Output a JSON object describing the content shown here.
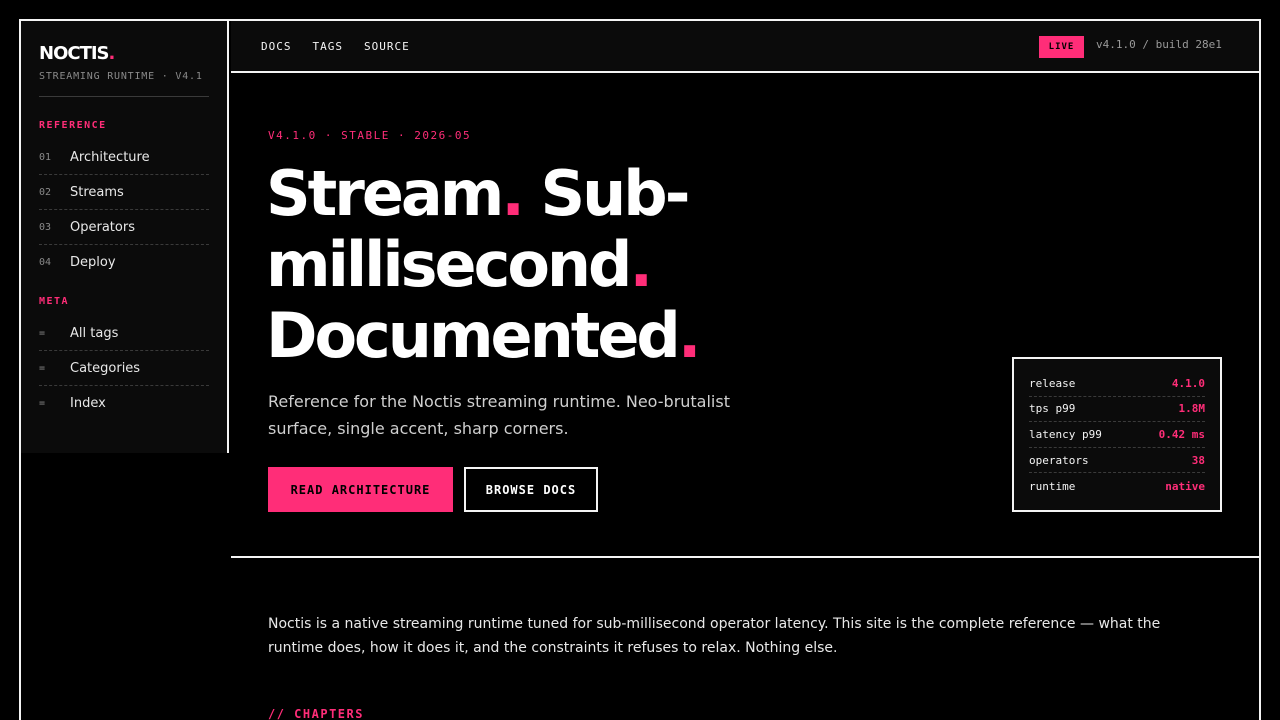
{
  "brand": {
    "name": "NOCTIS",
    "dot": ".",
    "subtitle": "STREAMING RUNTIME · V4.1"
  },
  "sidebar": {
    "reference_heading": "REFERENCE",
    "reference_items": [
      {
        "num": "01",
        "label": "Architecture"
      },
      {
        "num": "02",
        "label": "Streams"
      },
      {
        "num": "03",
        "label": "Operators"
      },
      {
        "num": "04",
        "label": "Deploy"
      }
    ],
    "meta_heading": "META",
    "meta_items": [
      {
        "num": "=",
        "label": "All tags"
      },
      {
        "num": "=",
        "label": "Categories"
      },
      {
        "num": "=",
        "label": "Index"
      }
    ]
  },
  "topnav": {
    "links": [
      "DOCS",
      "TAGS",
      "SOURCE"
    ],
    "live_badge": "LIVE",
    "build": "v4.1.0 / build 28e1"
  },
  "hero": {
    "eyebrow": "V4.1.0 · STABLE · 2026-05",
    "title_line1_a": "Stream",
    "title_line1_b": "Sub-",
    "title_line2": "millisecond",
    "title_line3": "Documented",
    "dot": ".",
    "subtitle": "Reference for the Noctis streaming runtime. Neo-brutalist surface, single accent, sharp corners.",
    "primary_cta": "READ ARCHITECTURE",
    "secondary_cta": "BROWSE DOCS"
  },
  "stats": [
    {
      "key": "release",
      "value": "4.1.0"
    },
    {
      "key": "tps p99",
      "value": "1.8M"
    },
    {
      "key": "latency p99",
      "value": "0.42 ms"
    },
    {
      "key": "operators",
      "value": "38"
    },
    {
      "key": "runtime",
      "value": "native"
    }
  ],
  "intro": "Noctis is a native streaming runtime tuned for sub-millisecond operator latency. This site is the complete reference — what the runtime does, how it does it, and the constraints it refuses to relax. Nothing else.",
  "chapters_heading": "// CHAPTERS",
  "colors": {
    "accent": "#ff2d78",
    "background": "#000000",
    "foreground": "#f4f4f4"
  }
}
